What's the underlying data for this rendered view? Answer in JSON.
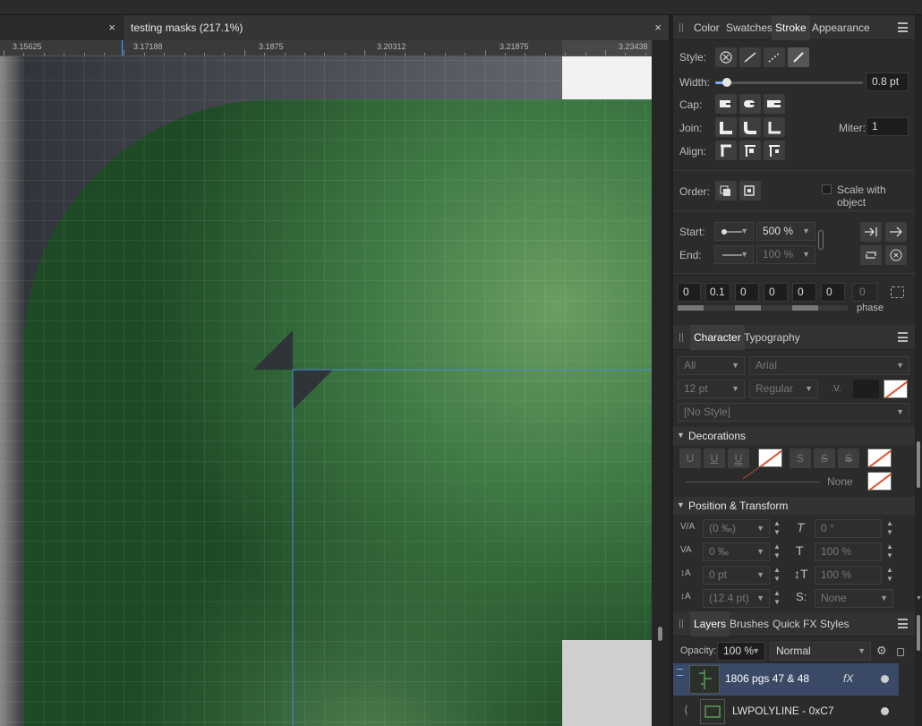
{
  "tabs": [
    {
      "label": "",
      "close": "×"
    },
    {
      "label": "testing masks (217.1%)",
      "close": "×"
    }
  ],
  "ruler": {
    "labels": [
      "3.15625",
      "3.17188",
      "3.1875",
      "3.20312",
      "3.21875",
      "3.23438"
    ]
  },
  "stroke_panel": {
    "tabs": [
      "Color",
      "Swatches",
      "Stroke",
      "Appearance"
    ],
    "active_tab": "Stroke",
    "style_label": "Style:",
    "width_label": "Width:",
    "width_value": "0.8 pt",
    "width_fraction": 0.08,
    "cap_label": "Cap:",
    "join_label": "Join:",
    "miter_label": "Miter:",
    "miter_value": "1",
    "align_label": "Align:",
    "order_label": "Order:",
    "scale_with_object": "Scale with object",
    "start_label": "Start:",
    "start_value": "500 %",
    "end_label": "End:",
    "end_value": "100 %",
    "dash_values": [
      "0",
      "0.1",
      "0",
      "0",
      "0",
      "0"
    ],
    "phase_value": "0",
    "phase_label": "phase"
  },
  "character_panel": {
    "tabs": [
      "Character",
      "Typography"
    ],
    "active_tab": "Character",
    "scope": "All",
    "font": "Arial",
    "size": "12 pt",
    "weight": "Regular",
    "style": "[No Style]",
    "decorations_title": "Decorations",
    "decor_none": "None",
    "position_title": "Position & Transform",
    "kerning": "(0 ‰)",
    "tracking": "0 ‰",
    "baseline": "0 pt",
    "leading": "(12.4 pt)",
    "shear": "0 °",
    "hscale": "100 %",
    "vscale": "100 %",
    "subsup": "None"
  },
  "layers_panel": {
    "tabs": [
      "Layers",
      "Brushes",
      "Quick FX",
      "Styles"
    ],
    "active_tab": "Layers",
    "opacity_label": "Opacity:",
    "opacity_value": "100 %",
    "blend_mode": "Normal",
    "items": [
      {
        "name": "1806 pgs 47 & 48",
        "fx": "fX"
      },
      {
        "name": "LWPOLYLINE - 0xC7"
      }
    ]
  },
  "colors": {
    "accent": "#4a90e2",
    "panel_bg": "#2b2b2b",
    "canvas_green": "#3f7a45",
    "selected_layer": "#3a4a66"
  }
}
